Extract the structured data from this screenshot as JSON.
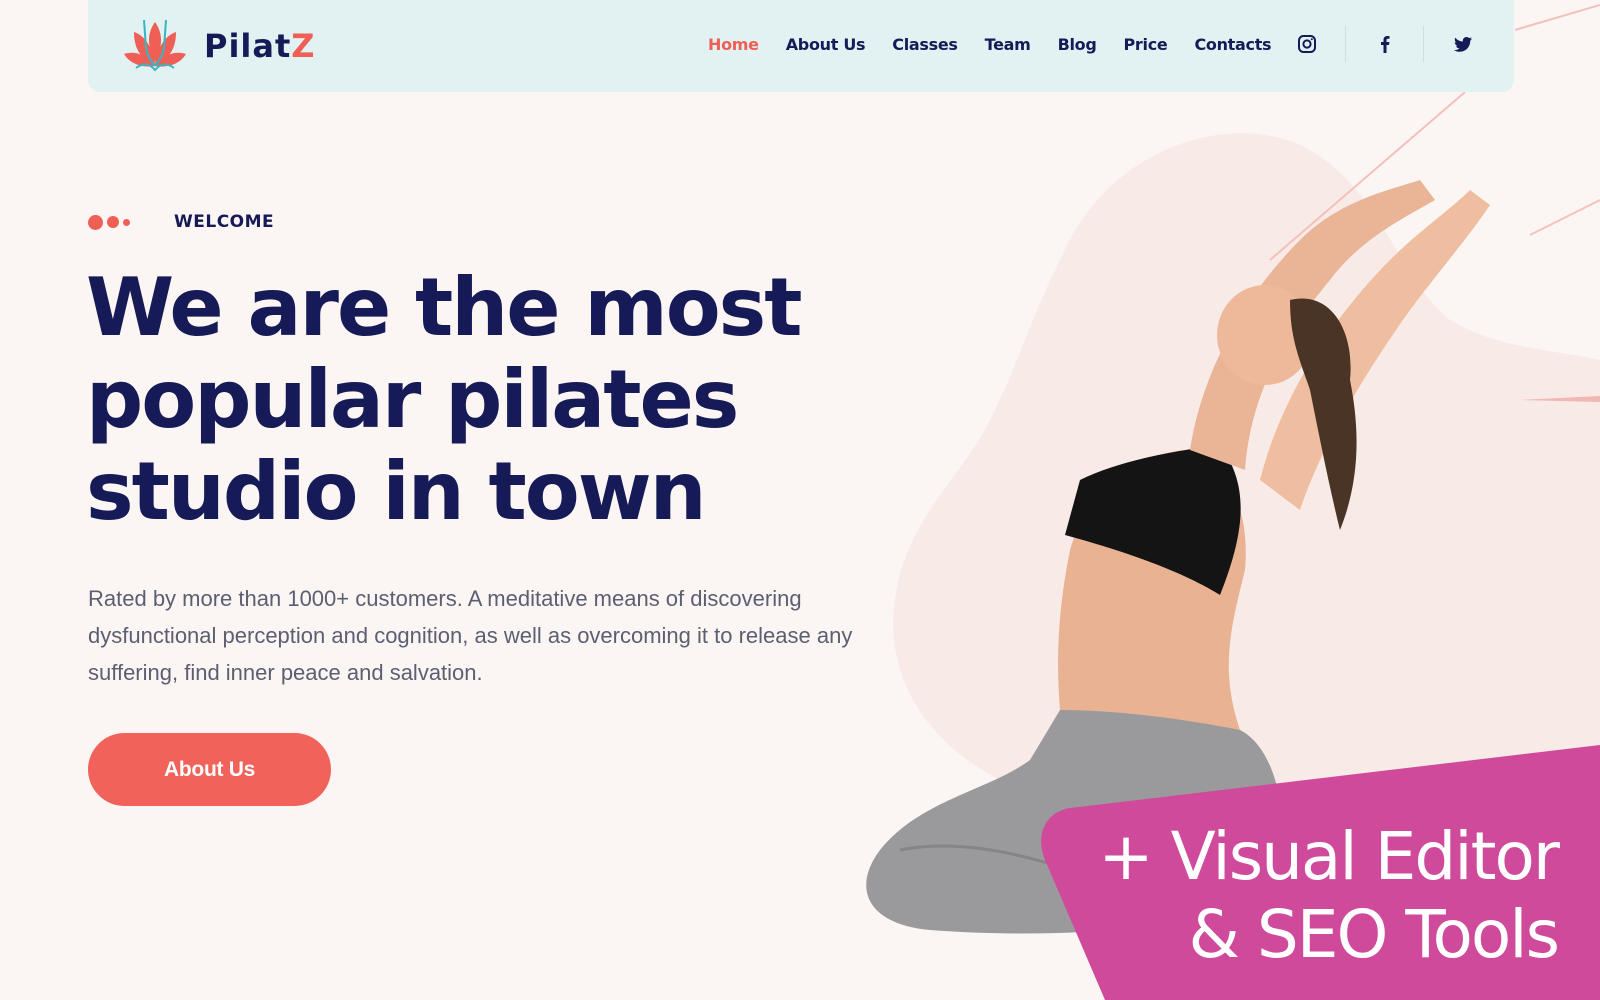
{
  "brand": {
    "name_main": "Pilat",
    "name_accent": "Z",
    "logo_icon": "lotus-icon"
  },
  "colors": {
    "accent": "#ef5f55",
    "navy": "#161a56",
    "header_bg": "#e2f1f1",
    "page_bg": "#fbf6f3",
    "promo": "#cf4a9a"
  },
  "nav": {
    "items": [
      {
        "label": "Home",
        "active": true
      },
      {
        "label": "About Us",
        "active": false
      },
      {
        "label": "Classes",
        "active": false
      },
      {
        "label": "Team",
        "active": false
      },
      {
        "label": "Blog",
        "active": false
      },
      {
        "label": "Price",
        "active": false
      },
      {
        "label": "Contacts",
        "active": false
      }
    ]
  },
  "social": [
    {
      "name": "instagram",
      "icon": "instagram-icon"
    },
    {
      "name": "facebook",
      "icon": "facebook-icon"
    },
    {
      "name": "twitter",
      "icon": "twitter-icon"
    }
  ],
  "hero": {
    "eyebrow": "WELCOME",
    "headline_lines": [
      "We are the most",
      "popular pilates",
      "studio in town"
    ],
    "lead": "Rated by more than 1000+ customers. A meditative means of discovering dysfunctional perception and cognition, as well as overcoming it to release any suffering, find inner peace and salvation.",
    "cta_label": "About Us",
    "image_alt": "woman stretching in pilates pose"
  },
  "promo": {
    "line1": "+ Visual Editor",
    "line2": "& SEO Tools"
  }
}
